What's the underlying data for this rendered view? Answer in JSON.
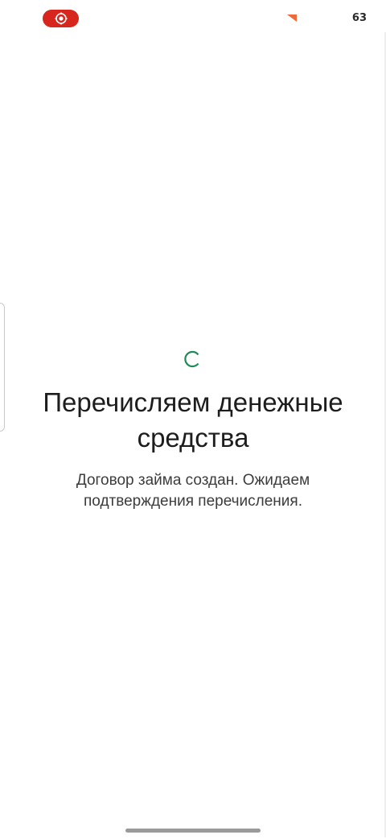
{
  "status_bar": {
    "record_icon": "screen-record-icon",
    "battery_level": "63"
  },
  "loading": {
    "spinner_icon": "loading-spinner-icon",
    "accent_color": "#1e8a55"
  },
  "main": {
    "title": "Перечисляем денежные средства",
    "subtitle": "Договор займа создан. Ожидаем подтверждения перечисления."
  },
  "colors": {
    "record_pill": "#d7261e",
    "signal_mark": "#ee6a3a",
    "text_primary": "#1d1d1d",
    "text_secondary": "#3c3c3c"
  }
}
